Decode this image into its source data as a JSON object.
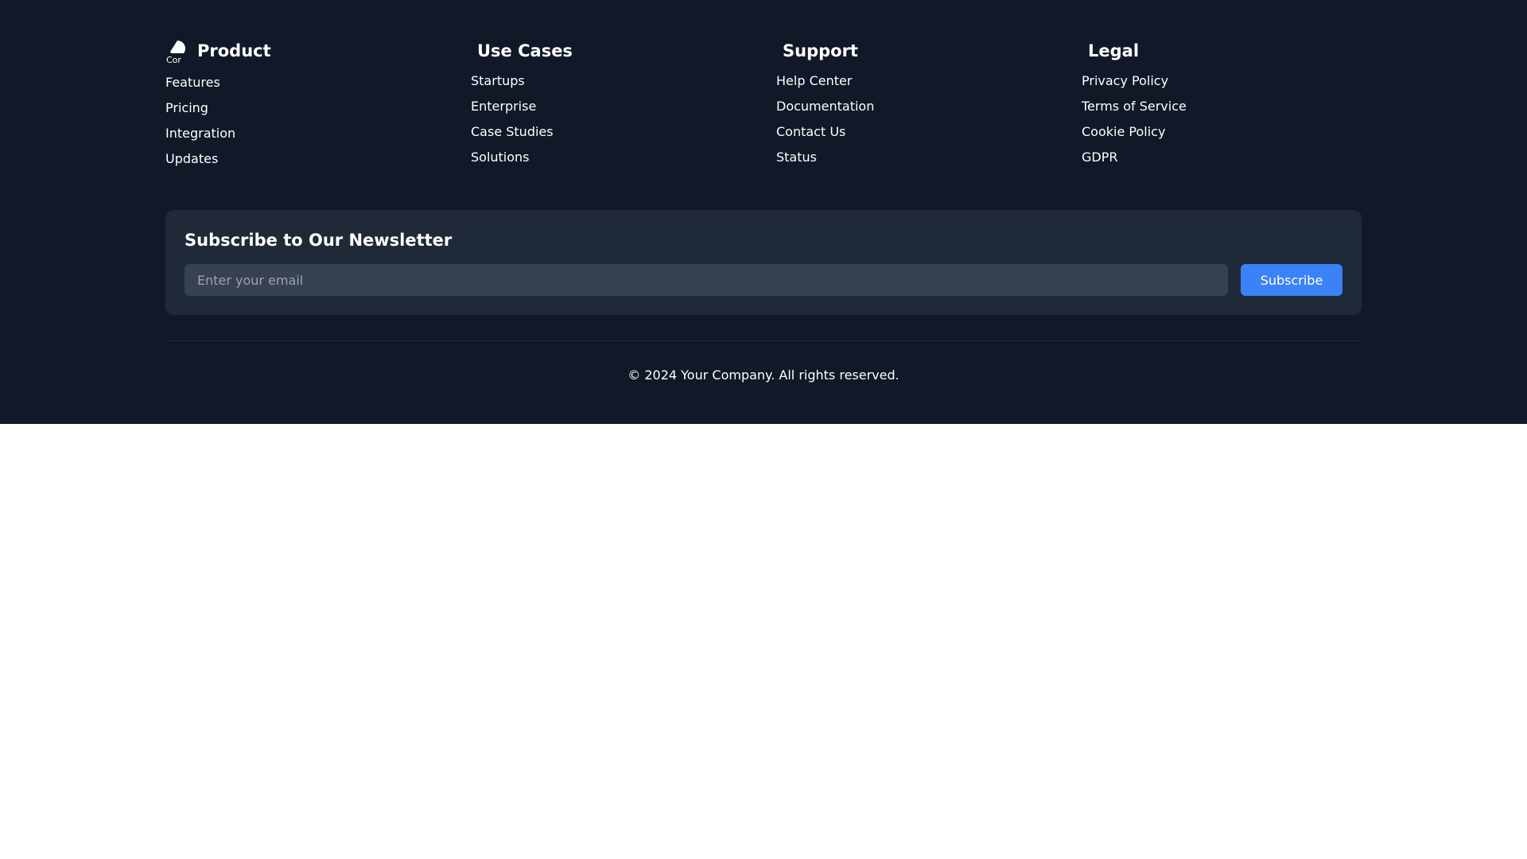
{
  "colors": {
    "footer_bg": "#111827",
    "panel_bg": "#1f2937",
    "input_bg": "#374151",
    "accent": "#3b82f6",
    "text": "#ffffff",
    "placeholder": "#9ca3af"
  },
  "columns": {
    "product": {
      "title": "Product",
      "logo_icon": "company-logo-icon",
      "links": [
        "Features",
        "Pricing",
        "Integration",
        "Updates"
      ]
    },
    "use_cases": {
      "title": "Use Cases",
      "links": [
        "Startups",
        "Enterprise",
        "Case Studies",
        "Solutions"
      ]
    },
    "support": {
      "title": "Support",
      "links": [
        "Help Center",
        "Documentation",
        "Contact Us",
        "Status"
      ]
    },
    "legal": {
      "title": "Legal",
      "links": [
        "Privacy Policy",
        "Terms of Service",
        "Cookie Policy",
        "GDPR"
      ]
    }
  },
  "newsletter": {
    "title": "Subscribe to Our Newsletter",
    "email_placeholder": "Enter your email",
    "email_value": "",
    "button_label": "Subscribe"
  },
  "copyright": "© 2024 Your Company. All rights reserved."
}
